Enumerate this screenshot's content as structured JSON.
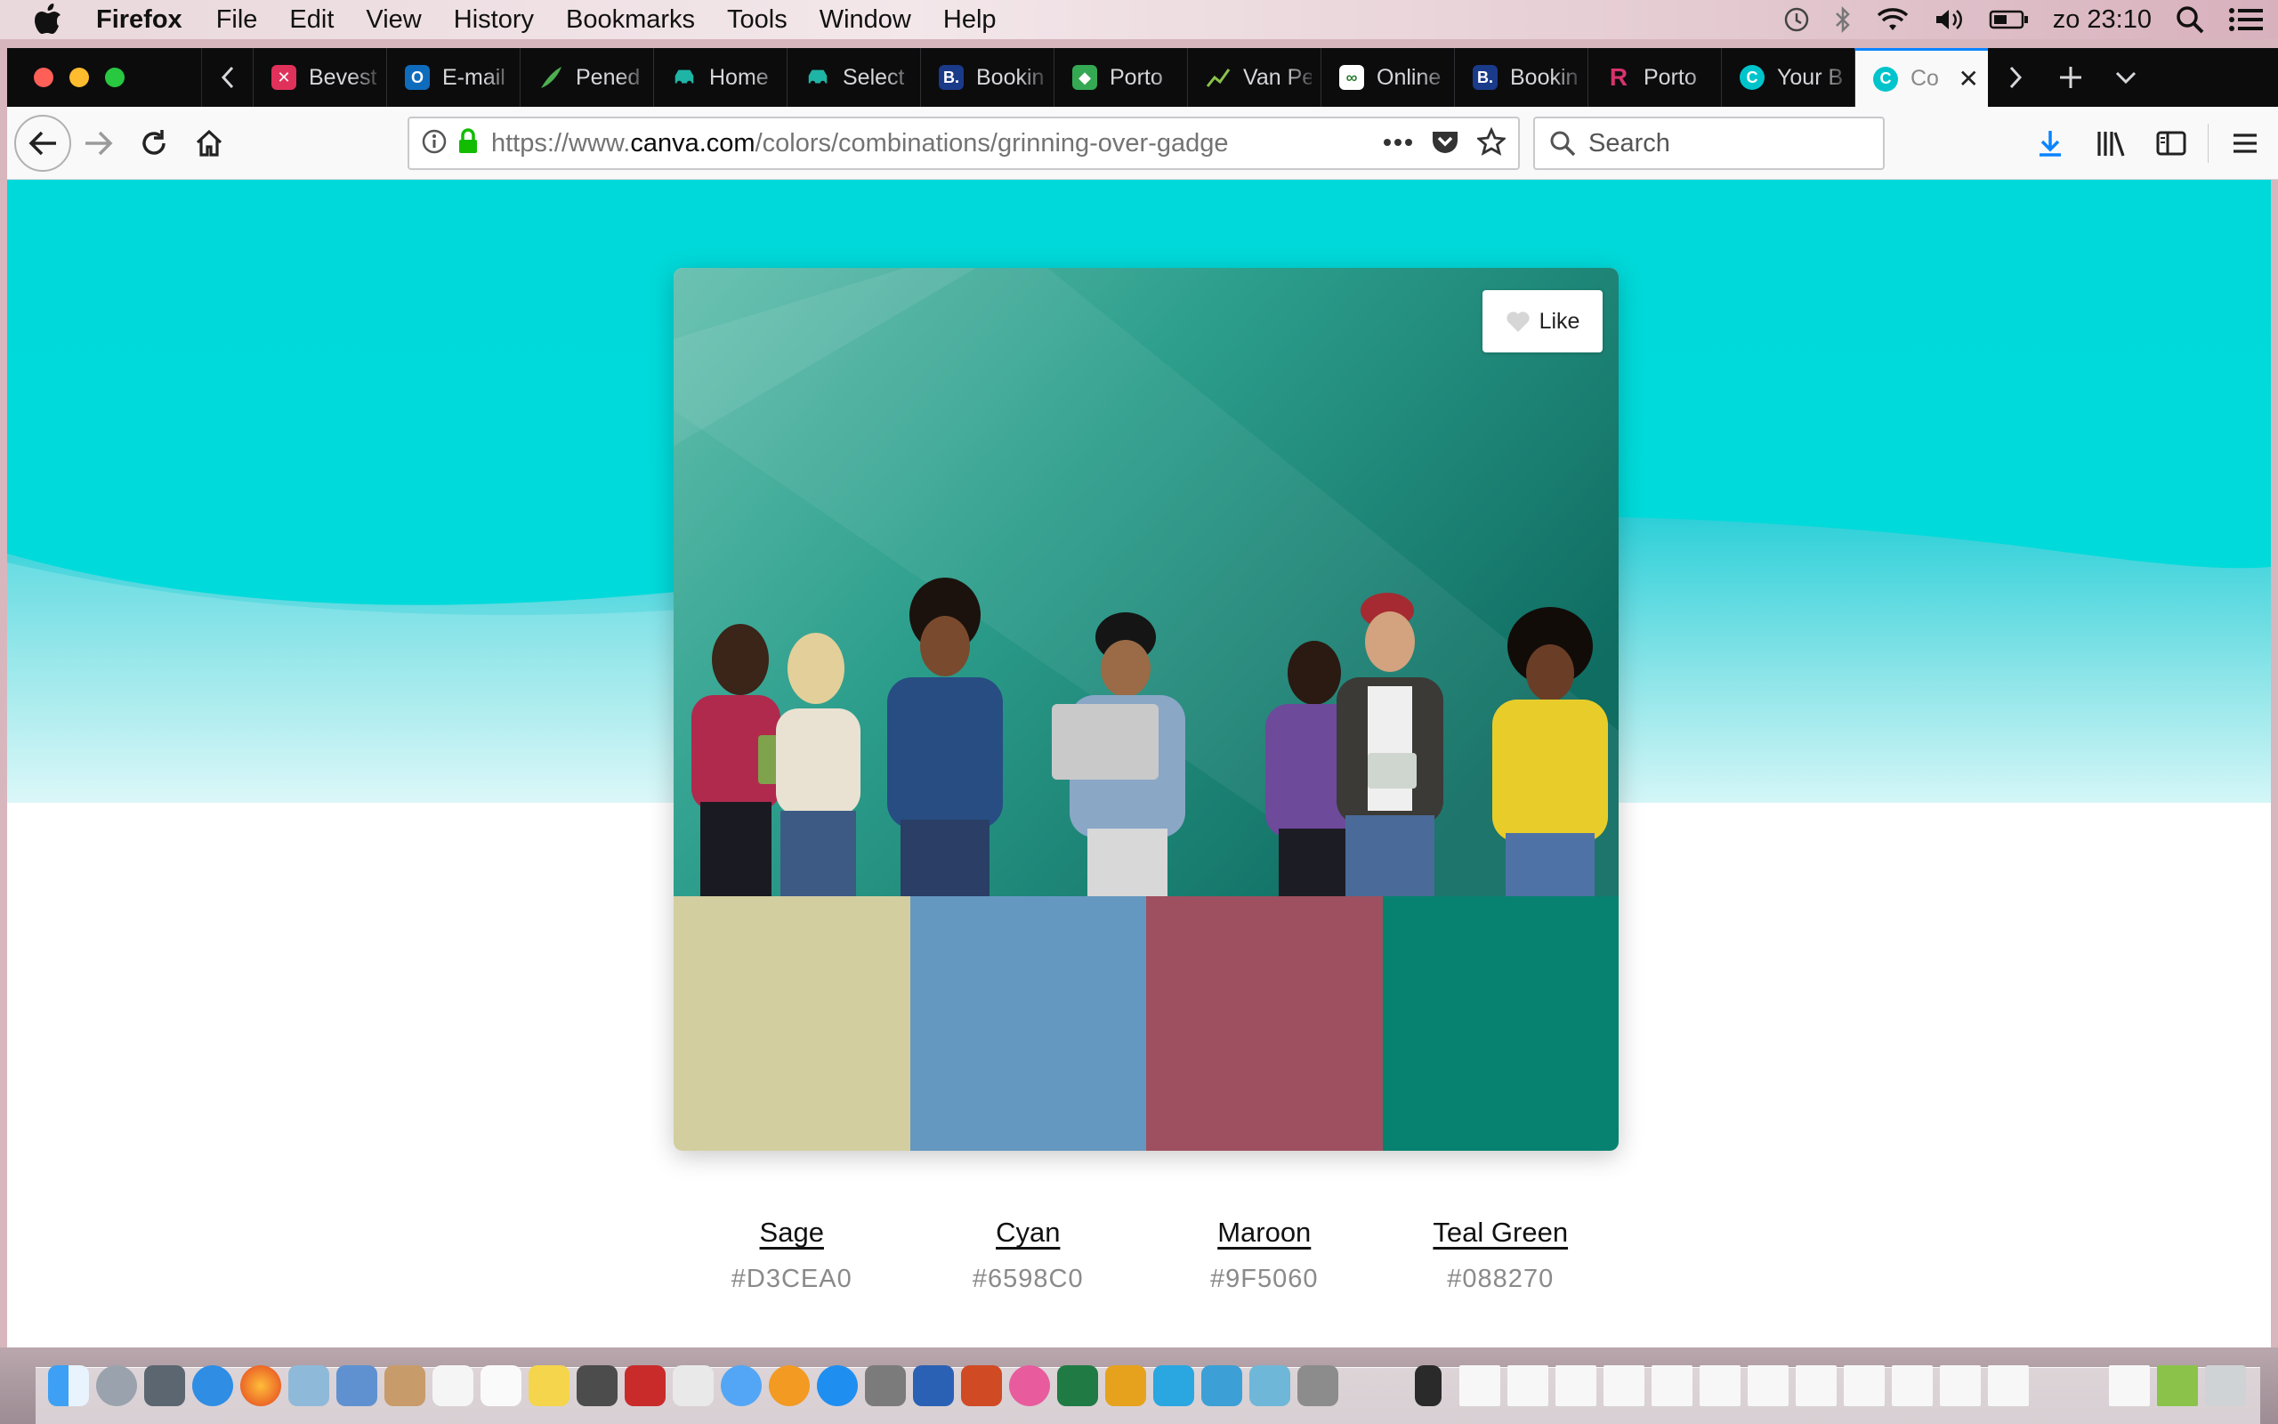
{
  "menubar": {
    "app_name": "Firefox",
    "menus": [
      "File",
      "Edit",
      "View",
      "History",
      "Bookmarks",
      "Tools",
      "Window",
      "Help"
    ],
    "clock": "zo 23:10",
    "status_icons": [
      "time-machine-icon",
      "bluetooth-icon",
      "wifi-icon",
      "volume-icon",
      "battery-icon",
      "spotlight-icon",
      "notification-center-icon"
    ]
  },
  "tabs": [
    {
      "label": "Bevest",
      "icon": "red-x-favicon",
      "color": "#e0315a"
    },
    {
      "label": "E-mail",
      "icon": "outlook-favicon",
      "color": "#0f6cbd"
    },
    {
      "label": "Pened",
      "icon": "leaf-favicon",
      "color": "#4caf50"
    },
    {
      "label": "Home",
      "icon": "car-favicon",
      "color": "#1fb5a6"
    },
    {
      "label": "Select",
      "icon": "car-favicon",
      "color": "#1fb5a6"
    },
    {
      "label": "Bookin",
      "icon": "booking-favicon",
      "color": "#1a3a8a"
    },
    {
      "label": "Porto",
      "icon": "google-maps-favicon",
      "color": "#34a853"
    },
    {
      "label": "Van Pe",
      "icon": "chart-favicon",
      "color": "#6b8e23"
    },
    {
      "label": "Online",
      "icon": "link-favicon",
      "color": "#2e7d32"
    },
    {
      "label": "Bookin",
      "icon": "booking-favicon",
      "color": "#1a3a8a"
    },
    {
      "label": "Porto",
      "icon": "r-favicon",
      "color": "#d6336c"
    },
    {
      "label": "Your B",
      "icon": "canva-favicon",
      "color": "#00c4cc"
    },
    {
      "label": "Co",
      "icon": "canva-favicon",
      "color": "#00c4cc",
      "active": true
    }
  ],
  "navbar": {
    "url_prefix": "https://www.",
    "url_host": "canva.com",
    "url_path": "/colors/combinations/grinning-over-gadge",
    "search_placeholder": "Search"
  },
  "page": {
    "like_label": "Like",
    "colors": [
      {
        "name": "Sage",
        "hex": "#D3CEA0"
      },
      {
        "name": "Cyan",
        "hex": "#6598C0"
      },
      {
        "name": "Maroon",
        "hex": "#9F5060"
      },
      {
        "name": "Teal Green",
        "hex": "#088270"
      }
    ],
    "hero_color": "#00d9d9"
  }
}
